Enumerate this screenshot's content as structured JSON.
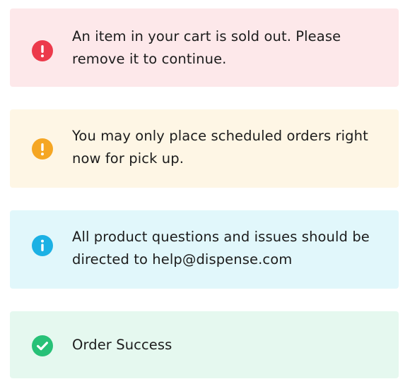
{
  "alerts": [
    {
      "type": "error",
      "icon": "exclamation-icon",
      "color": "#ec3a4b",
      "background": "#fde8ea",
      "message": "An item in your cart is sold out. Please remove it to continue."
    },
    {
      "type": "warning",
      "icon": "exclamation-icon",
      "color": "#f5a623",
      "background": "#fef6e5",
      "message": "You may only place scheduled orders right now for pick up."
    },
    {
      "type": "info",
      "icon": "info-icon",
      "color": "#1cb1e4",
      "background": "#e1f7fb",
      "message": "All product questions and issues should be directed to help@dispense.com"
    },
    {
      "type": "success",
      "icon": "checkmark-icon",
      "color": "#27c177",
      "background": "#e5f8ef",
      "message": "Order Success"
    }
  ]
}
